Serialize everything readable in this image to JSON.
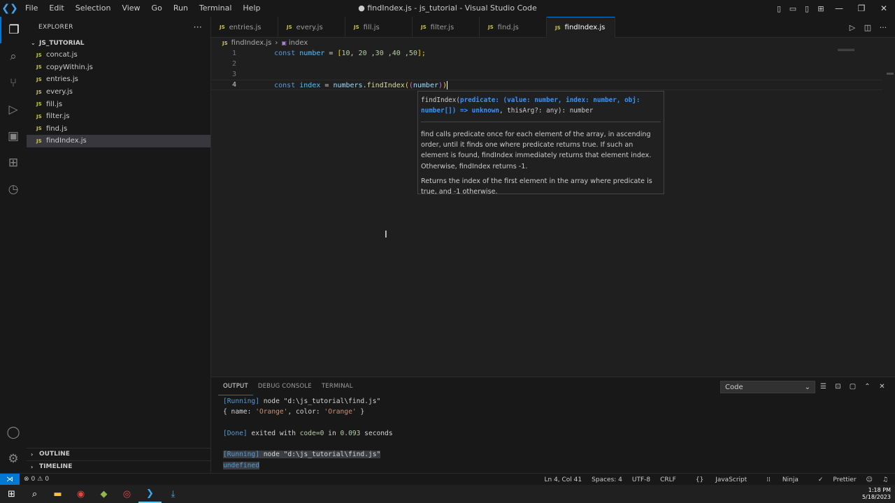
{
  "titlebar": {
    "menu": [
      "File",
      "Edit",
      "Selection",
      "View",
      "Go",
      "Run",
      "Terminal",
      "Help"
    ],
    "title": "● findIndex.js - js_tutorial - Visual Studio Code"
  },
  "sidebar": {
    "header": "EXPLORER",
    "more": "···",
    "folder": "JS_TUTORIAL",
    "files": [
      "concat.js",
      "copyWithin.js",
      "entries.js",
      "every.js",
      "fill.js",
      "filter.js",
      "find.js",
      "findIndex.js"
    ],
    "selected_file": "findIndex.js",
    "outline": "OUTLINE",
    "timeline": "TIMELINE",
    "file_badge": "JS"
  },
  "tabs": [
    {
      "label": "entries.js"
    },
    {
      "label": "every.js"
    },
    {
      "label": "fill.js"
    },
    {
      "label": "filter.js"
    },
    {
      "label": "find.js"
    },
    {
      "label": "findIndex.js",
      "active": true,
      "modified": true
    }
  ],
  "breadcrumb": {
    "file": "findIndex.js",
    "symbol": "index"
  },
  "editor": {
    "line_numbers": [
      "1",
      "2",
      "3",
      "4"
    ],
    "line1": {
      "kw": "const",
      "var": "number",
      "eq": " = ",
      "open": "[",
      "n1": "10",
      "c1": ", ",
      "n2": "20",
      "c2": " ,",
      "n3": "30",
      "c3": " ,",
      "n4": "40",
      "c4": " ,",
      "n5": "50",
      "close": "];"
    },
    "line4": {
      "kw": "const",
      "var": "index",
      "eq": " = ",
      "obj": "numbers",
      "dot": ".",
      "fn": "findIndex",
      "p1": "(",
      "p2": "(",
      "param": "number",
      "p3": ")",
      "p4": ")"
    }
  },
  "hover": {
    "fn": "findIndex",
    "sig_open": "(",
    "param_text": "predicate: (value: number, index: number, obj: number[]) => unknown",
    "rest": ", thisArg?: any): number",
    "doc": "find calls predicate once for each element of the array, in ascending order, until it finds one where predicate returns true. If such an element is found, findIndex immediately returns that element index. Otherwise, findIndex returns -1.",
    "returns": "Returns the index of the first element in the array where predicate is true, and -1 otherwise."
  },
  "panel": {
    "tabs": [
      "OUTPUT",
      "DEBUG CONSOLE",
      "TERMINAL"
    ],
    "active_tab": "OUTPUT",
    "channel": "Code",
    "output": {
      "run1_tag": "[Running]",
      "run1_cmd": " node \"d:\\js_tutorial\\find.js\"",
      "obj_open": "{ name: ",
      "obj_name": "'Orange'",
      "obj_mid": ", color: ",
      "obj_color": "'Orange'",
      "obj_close": " }",
      "done_tag": "[Done]",
      "done_text": " exited with ",
      "done_code": "code=0",
      "done_in": " in ",
      "done_secs": "0.093",
      "done_unit": " seconds",
      "run2_tag": "[Running]",
      "run2_cmd": " node \"d:\\js_tutorial\\find.js\"",
      "result": "undefined"
    }
  },
  "statusbar": {
    "errors": "0",
    "warnings": "0",
    "position": "Ln 4, Col 41",
    "spaces": "Spaces: 4",
    "encoding": "UTF-8",
    "eol": "CRLF",
    "language": "JavaScript",
    "ninja": "Ninja",
    "prettier": "Prettier"
  },
  "taskbar": {
    "time": "1:18 PM",
    "date": "5/18/2023"
  }
}
